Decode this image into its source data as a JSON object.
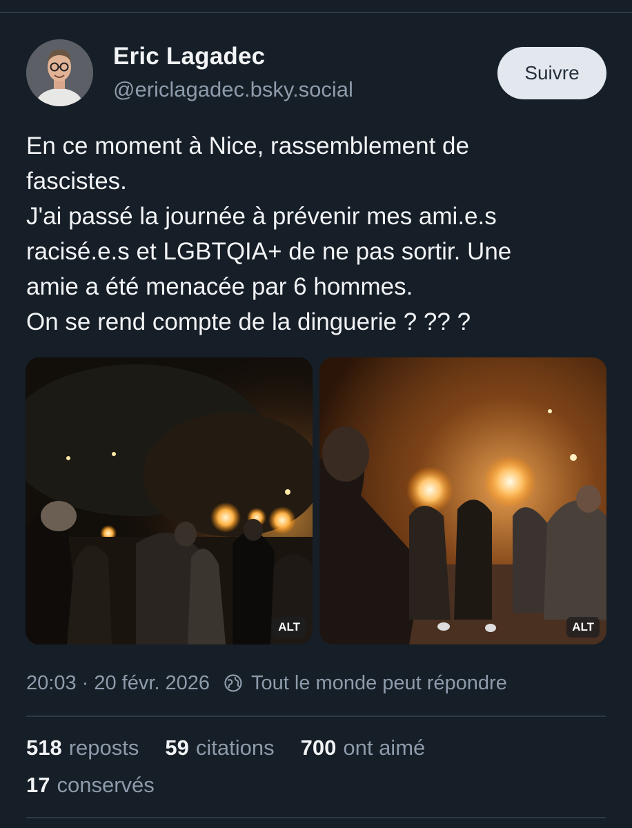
{
  "author": {
    "display_name": "Eric Lagadec",
    "handle": "@ericlagadec.bsky.social"
  },
  "follow_label": "Suivre",
  "post_text": "En ce moment à Nice, rassemblement de\nfascistes.\nJ'ai passé la journée à prévenir mes ami.e.s\nracisé.e.s et LGBTQIA+ de ne pas sortir. Une\namie a été menacée par 6 hommes.\nOn se rend compte de la dinguerie ? ?? ?",
  "images": [
    {
      "alt_badge": "ALT"
    },
    {
      "alt_badge": "ALT"
    }
  ],
  "meta": {
    "timestamp": "20:03 · 20 févr. 2026",
    "reply_setting": "Tout le monde peut répondre",
    "reply_icon": "globe-icon"
  },
  "stats": {
    "reposts_count": "518",
    "reposts_label": "reposts",
    "quotes_count": "59",
    "quotes_label": "citations",
    "likes_count": "700",
    "likes_label": "ont aimé",
    "saves_count": "17",
    "saves_label": "conservés"
  },
  "colors": {
    "background": "#161e27",
    "text": "#f1f3f5",
    "muted": "#8e9bab",
    "button_bg": "#e3e8ee"
  }
}
